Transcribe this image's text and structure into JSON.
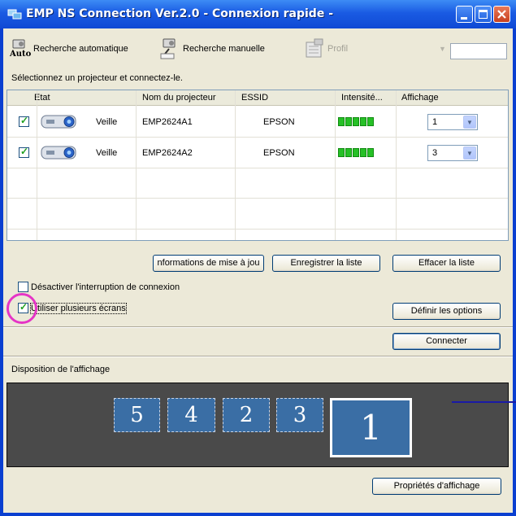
{
  "window": {
    "title": "EMP NS Connection Ver.2.0 - Connexion rapide -"
  },
  "toolbar": {
    "auto_search": "Recherche automatique",
    "auto_badge": "Auto",
    "manual_search": "Recherche manuelle",
    "profile": "Profil"
  },
  "hint": "Sélectionnez un projecteur et connectez-le.",
  "table": {
    "columns": [
      "Etat",
      "Nom du projecteur",
      "ESSID",
      "Intensité...",
      "Affichage"
    ],
    "rows": [
      {
        "checked": true,
        "status": "Veille",
        "name": "EMP2624A1",
        "essid": "EPSON",
        "signal_bars": 5,
        "display": "1"
      },
      {
        "checked": true,
        "status": "Veille",
        "name": "EMP2624A2",
        "essid": "EPSON",
        "signal_bars": 5,
        "display": "3"
      }
    ]
  },
  "buttons": {
    "update_info": "nformations de mise à jou",
    "save_list": "Enregistrer la liste",
    "clear_list": "Effacer la liste",
    "define_options": "Définir les options",
    "connect": "Connecter",
    "display_properties": "Propriétés d'affichage"
  },
  "options": {
    "disable_interrupt": {
      "label": "Désactiver l'interruption de connexion",
      "checked": false
    },
    "multi_screen": {
      "label": "Utiliser plusieurs écrans",
      "checked": true
    }
  },
  "layout_section": {
    "label": "Disposition de l'affichage",
    "screens": [
      "5",
      "4",
      "2",
      "3",
      "1"
    ]
  },
  "colors": {
    "title_bar": "#1a5be3",
    "highlight": "#e534c6",
    "signal": "#26c026"
  }
}
